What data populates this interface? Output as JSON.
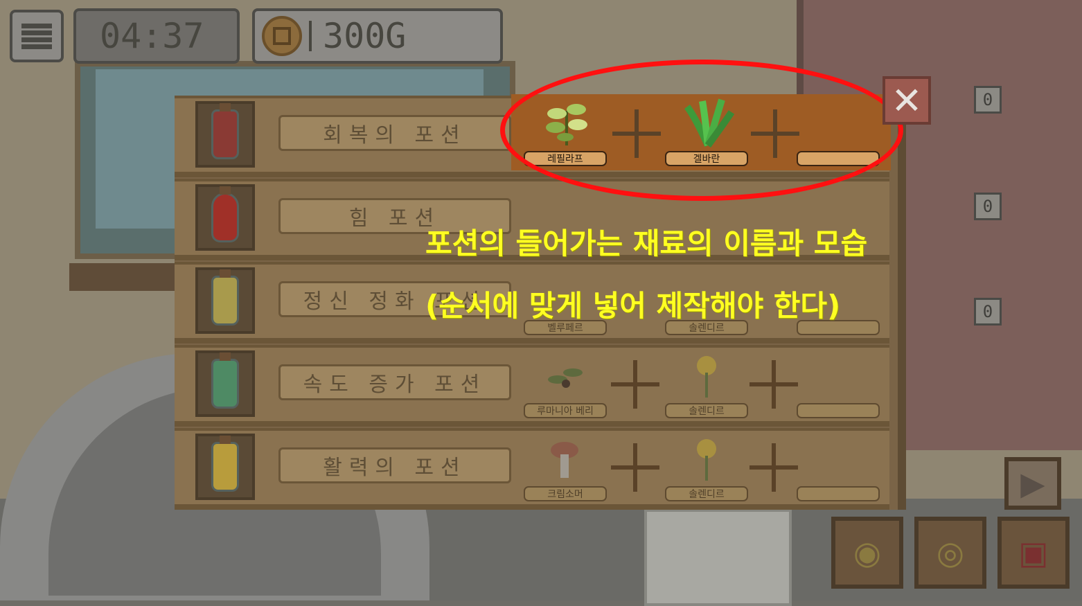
{
  "hud": {
    "timer": "04:37",
    "gold": "300G"
  },
  "recipes": [
    {
      "name": "회복의 포션",
      "potion_color": "#8a3a34",
      "ingredients": [
        "레필라프",
        "겔바란",
        ""
      ]
    },
    {
      "name": "힘 포션",
      "potion_color": "#a03028",
      "ingredients": [
        "",
        "",
        ""
      ]
    },
    {
      "name": "정신 정화 포션",
      "potion_color": "#a89a4c",
      "ingredients": [
        "벨루페르",
        "솔렌디르",
        ""
      ]
    },
    {
      "name": "속도 증가 포션",
      "potion_color": "#4e8a64",
      "ingredients": [
        "루마니아 베리",
        "솔렌디르",
        ""
      ]
    },
    {
      "name": "활력의 포션",
      "potion_color": "#b89c3c",
      "ingredients": [
        "크림소머",
        "솔렌디르",
        ""
      ]
    }
  ],
  "board": {
    "counts": [
      "0",
      "0",
      "0"
    ]
  },
  "annotation": {
    "line1": "포션의 들어가는 재료의 이름과 모습",
    "line2": "(순서에 맞게 넣어 제작해야 한다)",
    "highlight_color": "#ff1010",
    "text_color": "#ffff22"
  },
  "icons": {
    "menu": "hamburger-icon",
    "coin": "coin-icon",
    "close": "close-icon",
    "next": "play-arrow-icon",
    "hint": "lightbulb-icon",
    "shop": "coin-icon",
    "book": "book-icon"
  }
}
